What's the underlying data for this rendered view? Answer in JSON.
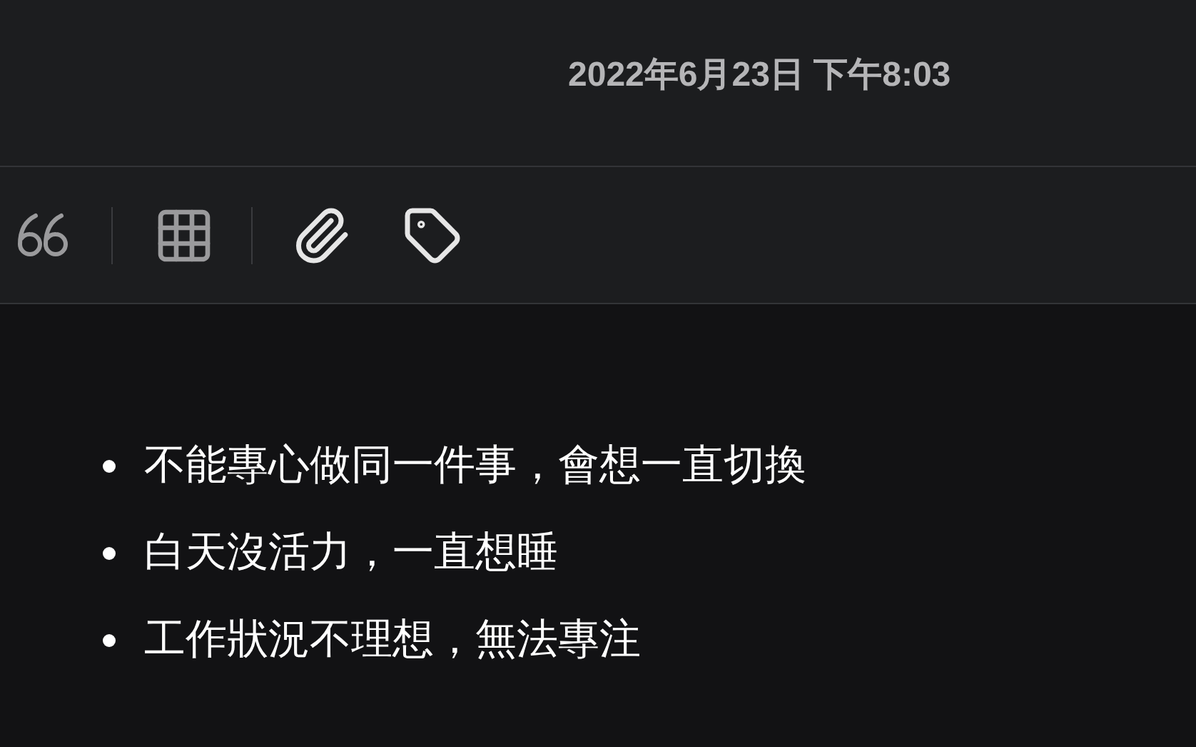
{
  "note": {
    "date": "2022年6月23日 下午8:03"
  },
  "bullets": [
    {
      "text": "不能專心做同一件事，會想一直切換"
    },
    {
      "text": "白天沒活力，一直想睡"
    },
    {
      "text": "工作狀況不理想，無法專注"
    }
  ]
}
